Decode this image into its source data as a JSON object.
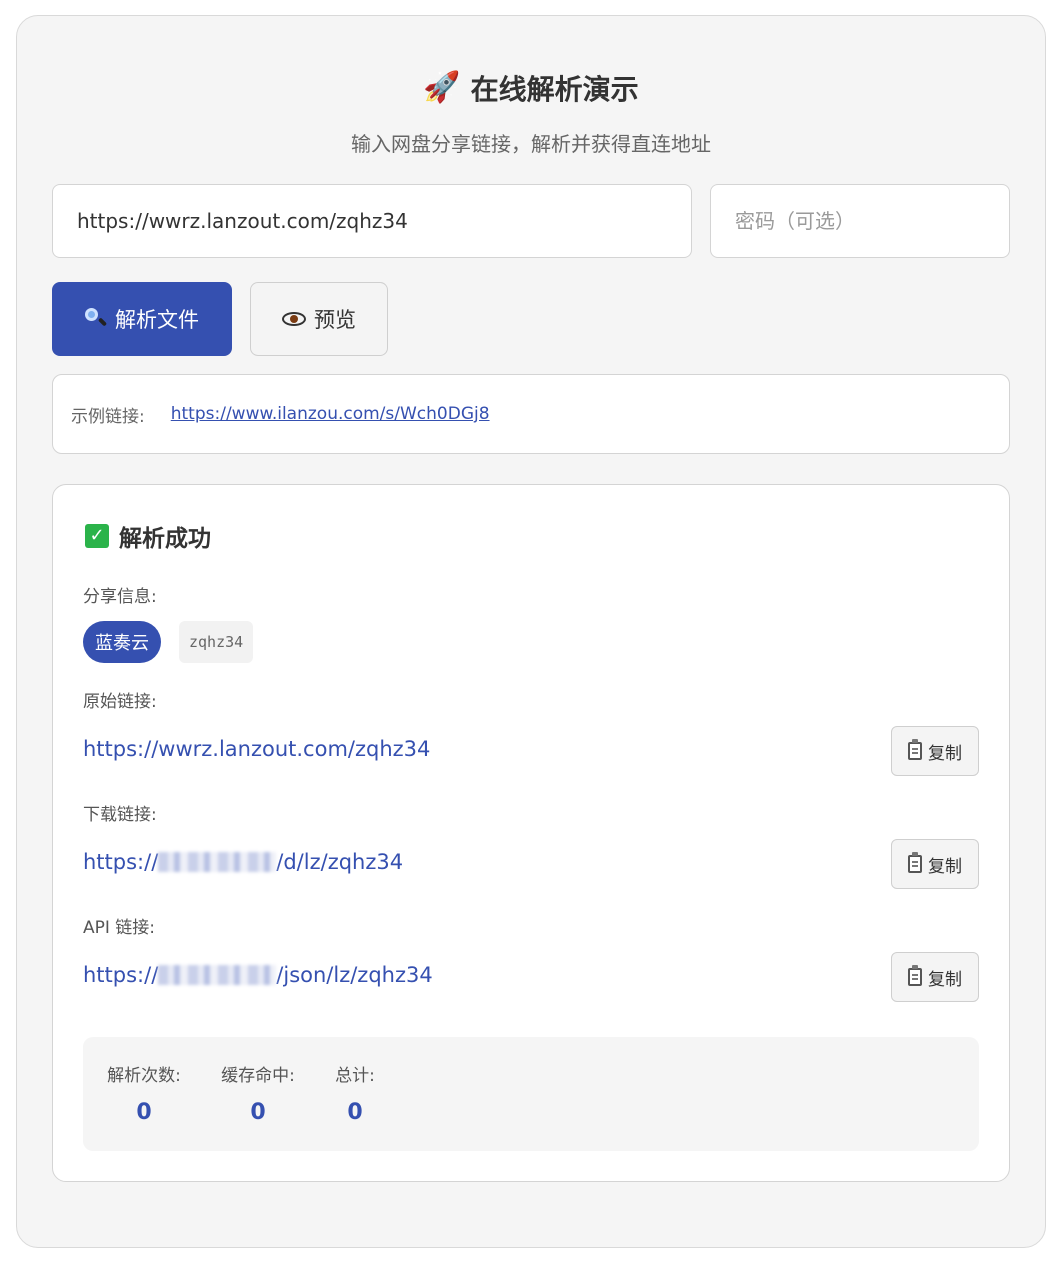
{
  "header": {
    "icon": "rocket-icon",
    "title": "在线解析演示",
    "subtitle": "输入网盘分享链接，解析并获得直连地址"
  },
  "form": {
    "url_value": "https://wwrz.lanzout.com/zqhz34",
    "password_placeholder": "密码（可选）",
    "parse_label": "解析文件",
    "preview_label": "预览"
  },
  "example": {
    "label": "示例链接:",
    "link": "https://www.ilanzou.com/s/Wch0DGj8"
  },
  "result": {
    "title": "解析成功",
    "share_info_label": "分享信息:",
    "provider_tag": "蓝奏云",
    "share_code": "zqhz34",
    "original_label": "原始链接:",
    "original_link": "https://wwrz.lanzout.com/zqhz34",
    "download_label": "下载链接:",
    "download_link_prefix": "https://",
    "download_link_suffix": "/d/lz/zqhz34",
    "api_label": "API 链接:",
    "api_link_prefix": "https://",
    "api_link_suffix": "/json/lz/zqhz34",
    "copy_label": "复制"
  },
  "stats": {
    "parse_count_label": "解析次数:",
    "parse_count": "0",
    "cache_hit_label": "缓存命中:",
    "cache_hit": "0",
    "total_label": "总计:",
    "total": "0"
  },
  "colors": {
    "accent": "#3550b0",
    "background": "#f5f5f5",
    "success": "#2bb34a"
  }
}
